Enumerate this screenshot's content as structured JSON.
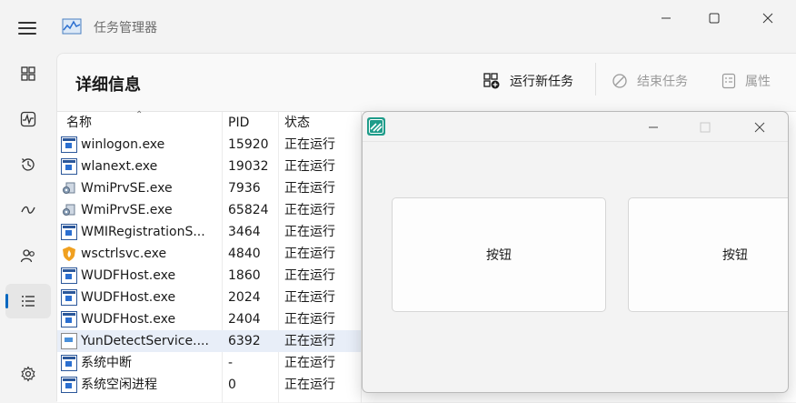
{
  "app": {
    "title": "任务管理器"
  },
  "page": {
    "title": "详细信息"
  },
  "commands": {
    "run_new_task": "运行新任务",
    "end_task": "结束任务",
    "properties": "属性"
  },
  "columns": {
    "name": "名称",
    "pid": "PID",
    "status": "状态"
  },
  "rows": [
    {
      "name": "winlogon.exe",
      "pid": "15920",
      "status": "正在运行",
      "icon": "app-window-icon"
    },
    {
      "name": "wlanext.exe",
      "pid": "19032",
      "status": "正在运行",
      "icon": "app-window-icon"
    },
    {
      "name": "WmiPrvSE.exe",
      "pid": "7936",
      "status": "正在运行",
      "icon": "wmi-service-icon"
    },
    {
      "name": "WmiPrvSE.exe",
      "pid": "65824",
      "status": "正在运行",
      "icon": "wmi-service-icon"
    },
    {
      "name": "WMIRegistrationS...",
      "pid": "3464",
      "status": "正在运行",
      "icon": "app-window-icon"
    },
    {
      "name": "wsctrlsvc.exe",
      "pid": "4840",
      "status": "正在运行",
      "icon": "shield-flame-icon"
    },
    {
      "name": "WUDFHost.exe",
      "pid": "1860",
      "status": "正在运行",
      "icon": "app-window-icon"
    },
    {
      "name": "WUDFHost.exe",
      "pid": "2024",
      "status": "正在运行",
      "icon": "app-window-icon"
    },
    {
      "name": "WUDFHost.exe",
      "pid": "2404",
      "status": "正在运行",
      "icon": "app-window-icon"
    },
    {
      "name": "YunDetectService....",
      "pid": "6392",
      "status": "正在运行",
      "icon": "document-icon"
    },
    {
      "name": "系统中断",
      "pid": "-",
      "status": "正在运行",
      "icon": "app-window-icon"
    },
    {
      "name": "系统空闲进程",
      "pid": "0",
      "status": "正在运行",
      "icon": "app-window-icon"
    }
  ],
  "overlay": {
    "buttons": [
      "按钮",
      "按钮"
    ]
  },
  "colors": {
    "accent": "#0067c0",
    "selection": "#e8eef8"
  }
}
